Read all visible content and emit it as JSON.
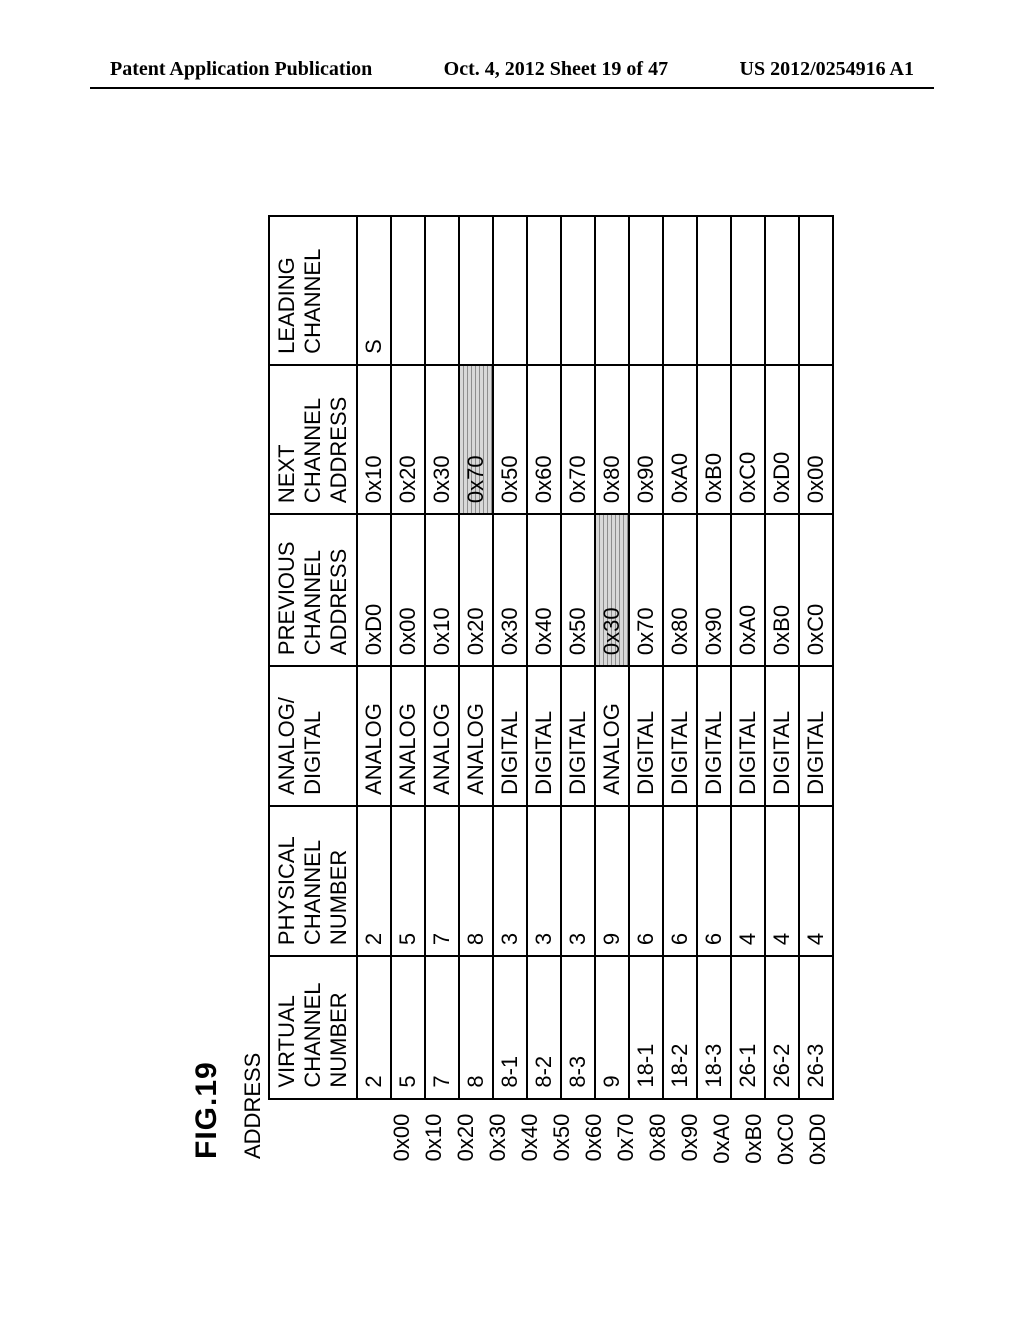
{
  "header": {
    "left": "Patent Application Publication",
    "center": "Oct. 4, 2012  Sheet 19 of 47",
    "right": "US 2012/0254916 A1"
  },
  "figure_label": "FIG.19",
  "address_label": "ADDRESS",
  "columns": {
    "virtual": "VIRTUAL\nCHANNEL\nNUMBER",
    "physical": "PHYSICAL\nCHANNEL\nNUMBER",
    "analog_digital": "ANALOG/\nDIGITAL",
    "previous": "PREVIOUS\nCHANNEL\nADDRESS",
    "next": "NEXT\nCHANNEL\nADDRESS",
    "leading": "LEADING\nCHANNEL"
  },
  "rows": [
    {
      "addr": "0x00",
      "virtual": "2",
      "physical": "2",
      "ad": "ANALOG",
      "prev": "0xD0",
      "next": "0x10",
      "leading": "S",
      "prev_hl": false,
      "next_hl": false
    },
    {
      "addr": "0x10",
      "virtual": "5",
      "physical": "5",
      "ad": "ANALOG",
      "prev": "0x00",
      "next": "0x20",
      "leading": "",
      "prev_hl": false,
      "next_hl": false
    },
    {
      "addr": "0x20",
      "virtual": "7",
      "physical": "7",
      "ad": "ANALOG",
      "prev": "0x10",
      "next": "0x30",
      "leading": "",
      "prev_hl": false,
      "next_hl": false
    },
    {
      "addr": "0x30",
      "virtual": "8",
      "physical": "8",
      "ad": "ANALOG",
      "prev": "0x20",
      "next": "0x70",
      "leading": "",
      "prev_hl": false,
      "next_hl": true
    },
    {
      "addr": "0x40",
      "virtual": "8-1",
      "physical": "3",
      "ad": "DIGITAL",
      "prev": "0x30",
      "next": "0x50",
      "leading": "",
      "prev_hl": false,
      "next_hl": false
    },
    {
      "addr": "0x50",
      "virtual": "8-2",
      "physical": "3",
      "ad": "DIGITAL",
      "prev": "0x40",
      "next": "0x60",
      "leading": "",
      "prev_hl": false,
      "next_hl": false
    },
    {
      "addr": "0x60",
      "virtual": "8-3",
      "physical": "3",
      "ad": "DIGITAL",
      "prev": "0x50",
      "next": "0x70",
      "leading": "",
      "prev_hl": false,
      "next_hl": false
    },
    {
      "addr": "0x70",
      "virtual": "9",
      "physical": "9",
      "ad": "ANALOG",
      "prev": "0x30",
      "next": "0x80",
      "leading": "",
      "prev_hl": true,
      "next_hl": false
    },
    {
      "addr": "0x80",
      "virtual": "18-1",
      "physical": "6",
      "ad": "DIGITAL",
      "prev": "0x70",
      "next": "0x90",
      "leading": "",
      "prev_hl": false,
      "next_hl": false
    },
    {
      "addr": "0x90",
      "virtual": "18-2",
      "physical": "6",
      "ad": "DIGITAL",
      "prev": "0x80",
      "next": "0xA0",
      "leading": "",
      "prev_hl": false,
      "next_hl": false
    },
    {
      "addr": "0xA0",
      "virtual": "18-3",
      "physical": "6",
      "ad": "DIGITAL",
      "prev": "0x90",
      "next": "0xB0",
      "leading": "",
      "prev_hl": false,
      "next_hl": false
    },
    {
      "addr": "0xB0",
      "virtual": "26-1",
      "physical": "4",
      "ad": "DIGITAL",
      "prev": "0xA0",
      "next": "0xC0",
      "leading": "",
      "prev_hl": false,
      "next_hl": false
    },
    {
      "addr": "0xC0",
      "virtual": "26-2",
      "physical": "4",
      "ad": "DIGITAL",
      "prev": "0xB0",
      "next": "0xD0",
      "leading": "",
      "prev_hl": false,
      "next_hl": false
    },
    {
      "addr": "0xD0",
      "virtual": "26-3",
      "physical": "4",
      "ad": "DIGITAL",
      "prev": "0xC0",
      "next": "0x00",
      "leading": "",
      "prev_hl": false,
      "next_hl": false
    }
  ]
}
